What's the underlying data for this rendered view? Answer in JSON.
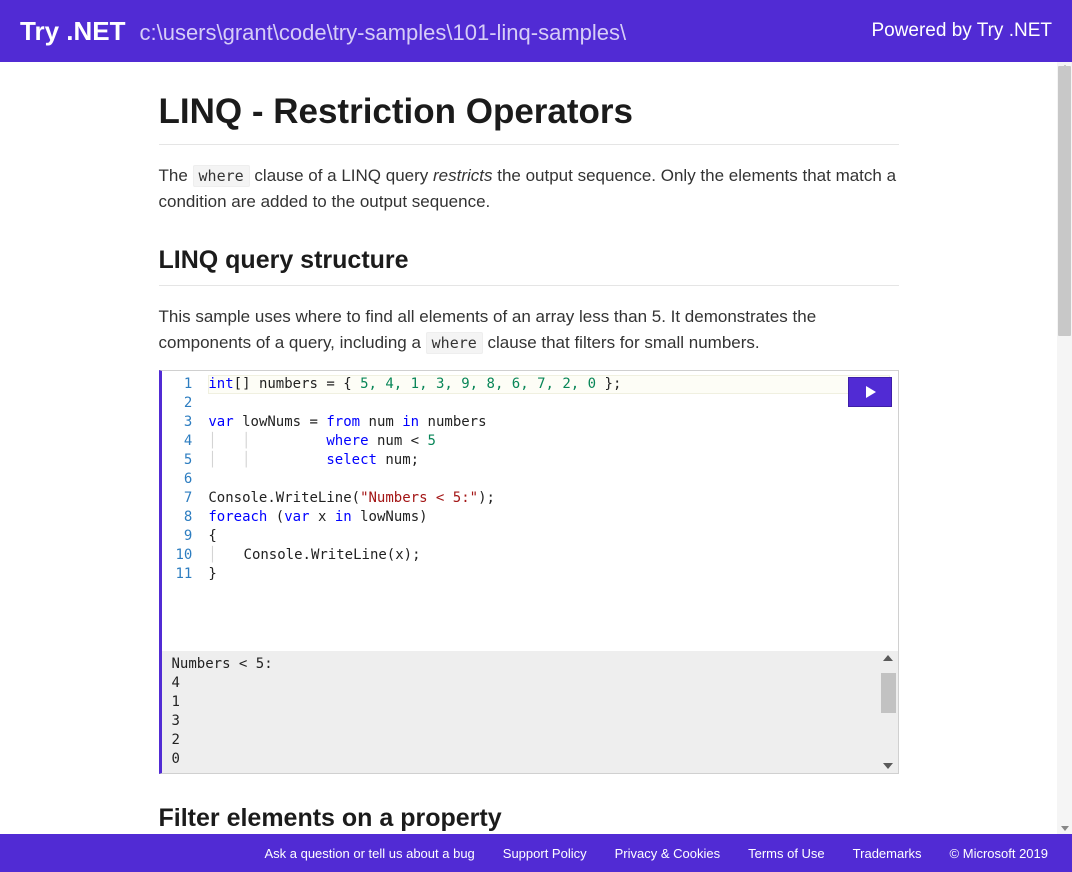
{
  "header": {
    "app_name": "Try .NET",
    "path": "c:\\users\\grant\\code\\try-samples\\101-linq-samples\\",
    "powered": "Powered by Try .NET"
  },
  "page": {
    "title": "LINQ - Restriction Operators",
    "intro_pre": "The ",
    "intro_code": "where",
    "intro_mid": " clause of a LINQ query ",
    "intro_em": "restricts",
    "intro_post": " the output sequence. Only the elements that match a condition are added to the output sequence.",
    "section1_title": "LINQ query structure",
    "section1_p_pre": "This sample uses where to find all elements of an array less than 5. It demonstrates the components of a query, including a ",
    "section1_p_code": "where",
    "section1_p_post": " clause that filters for small numbers.",
    "section2_title": "Filter elements on a property"
  },
  "editor": {
    "line_numbers": [
      "1",
      "2",
      "3",
      "4",
      "5",
      "6",
      "7",
      "8",
      "9",
      "10",
      "11"
    ],
    "code": {
      "l1_a": "int",
      "l1_b": "[] numbers = { ",
      "l1_nums": "5, 4, 1, 3, 9, 8, 6, 7, 2, 0",
      "l1_c": " };",
      "l3_a": "var",
      "l3_b": " lowNums = ",
      "l3_c": "from",
      "l3_d": " num ",
      "l3_e": "in",
      "l3_f": " numbers",
      "l4_a": "where",
      "l4_b": " num < ",
      "l4_c": "5",
      "l5_a": "select",
      "l5_b": " num;",
      "l7_a": "Console.WriteLine(",
      "l7_b": "\"Numbers < 5:\"",
      "l7_c": ");",
      "l8_a": "foreach",
      "l8_b": " (",
      "l8_c": "var",
      "l8_d": " x ",
      "l8_e": "in",
      "l8_f": " lowNums)",
      "l9": "{",
      "l10": "    Console.WriteLine(x);",
      "l11": "}"
    }
  },
  "output": {
    "text": "Numbers < 5:\n4\n1\n3\n2\n0"
  },
  "footer": {
    "ask": "Ask a question or tell us about a bug",
    "support": "Support Policy",
    "privacy": "Privacy & Cookies",
    "terms": "Terms of Use",
    "trademarks": "Trademarks",
    "copyright": "© Microsoft 2019"
  }
}
